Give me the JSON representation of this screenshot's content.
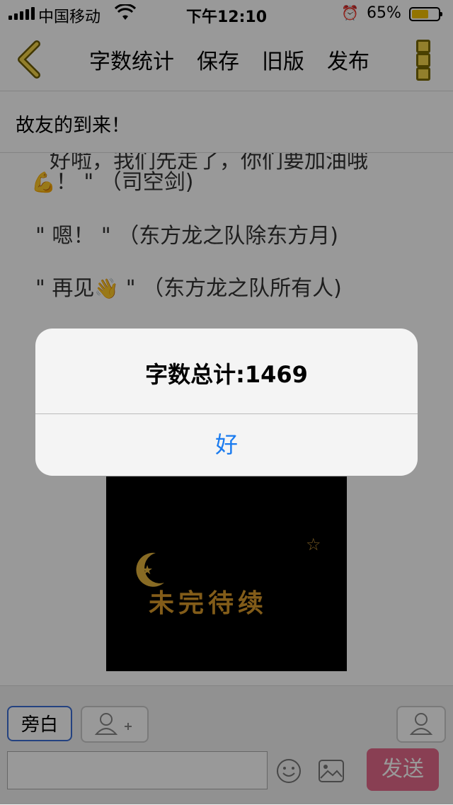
{
  "status_bar": {
    "carrier": "中国移动",
    "time": "下午12:10",
    "battery_pct": "65%",
    "battery_level": 0.65,
    "colors": {
      "battery_fill": "#f6c200"
    }
  },
  "navbar": {
    "items": [
      "字数统计",
      "保存",
      "旧版",
      "发布"
    ]
  },
  "chapter_title": "故友的到来！",
  "content": {
    "lines": [
      "好啦，我们先走了，你们要加油哦",
      "！ \" （司空剑)",
      "\" 嗯！ \" （东方龙之队除东方月)",
      "\" 再见",
      " \" （东方龙之队所有人)"
    ],
    "image_text": "未完待续"
  },
  "bottom_bar": {
    "narration_label": "旁白",
    "send_label": "发送",
    "colors": {
      "send": "#e56a8a",
      "narration_border": "#3d6fd6"
    }
  },
  "alert": {
    "message": "字数总计:1469",
    "ok_label": "好",
    "colors": {
      "ok_text": "#1a7bef"
    }
  }
}
